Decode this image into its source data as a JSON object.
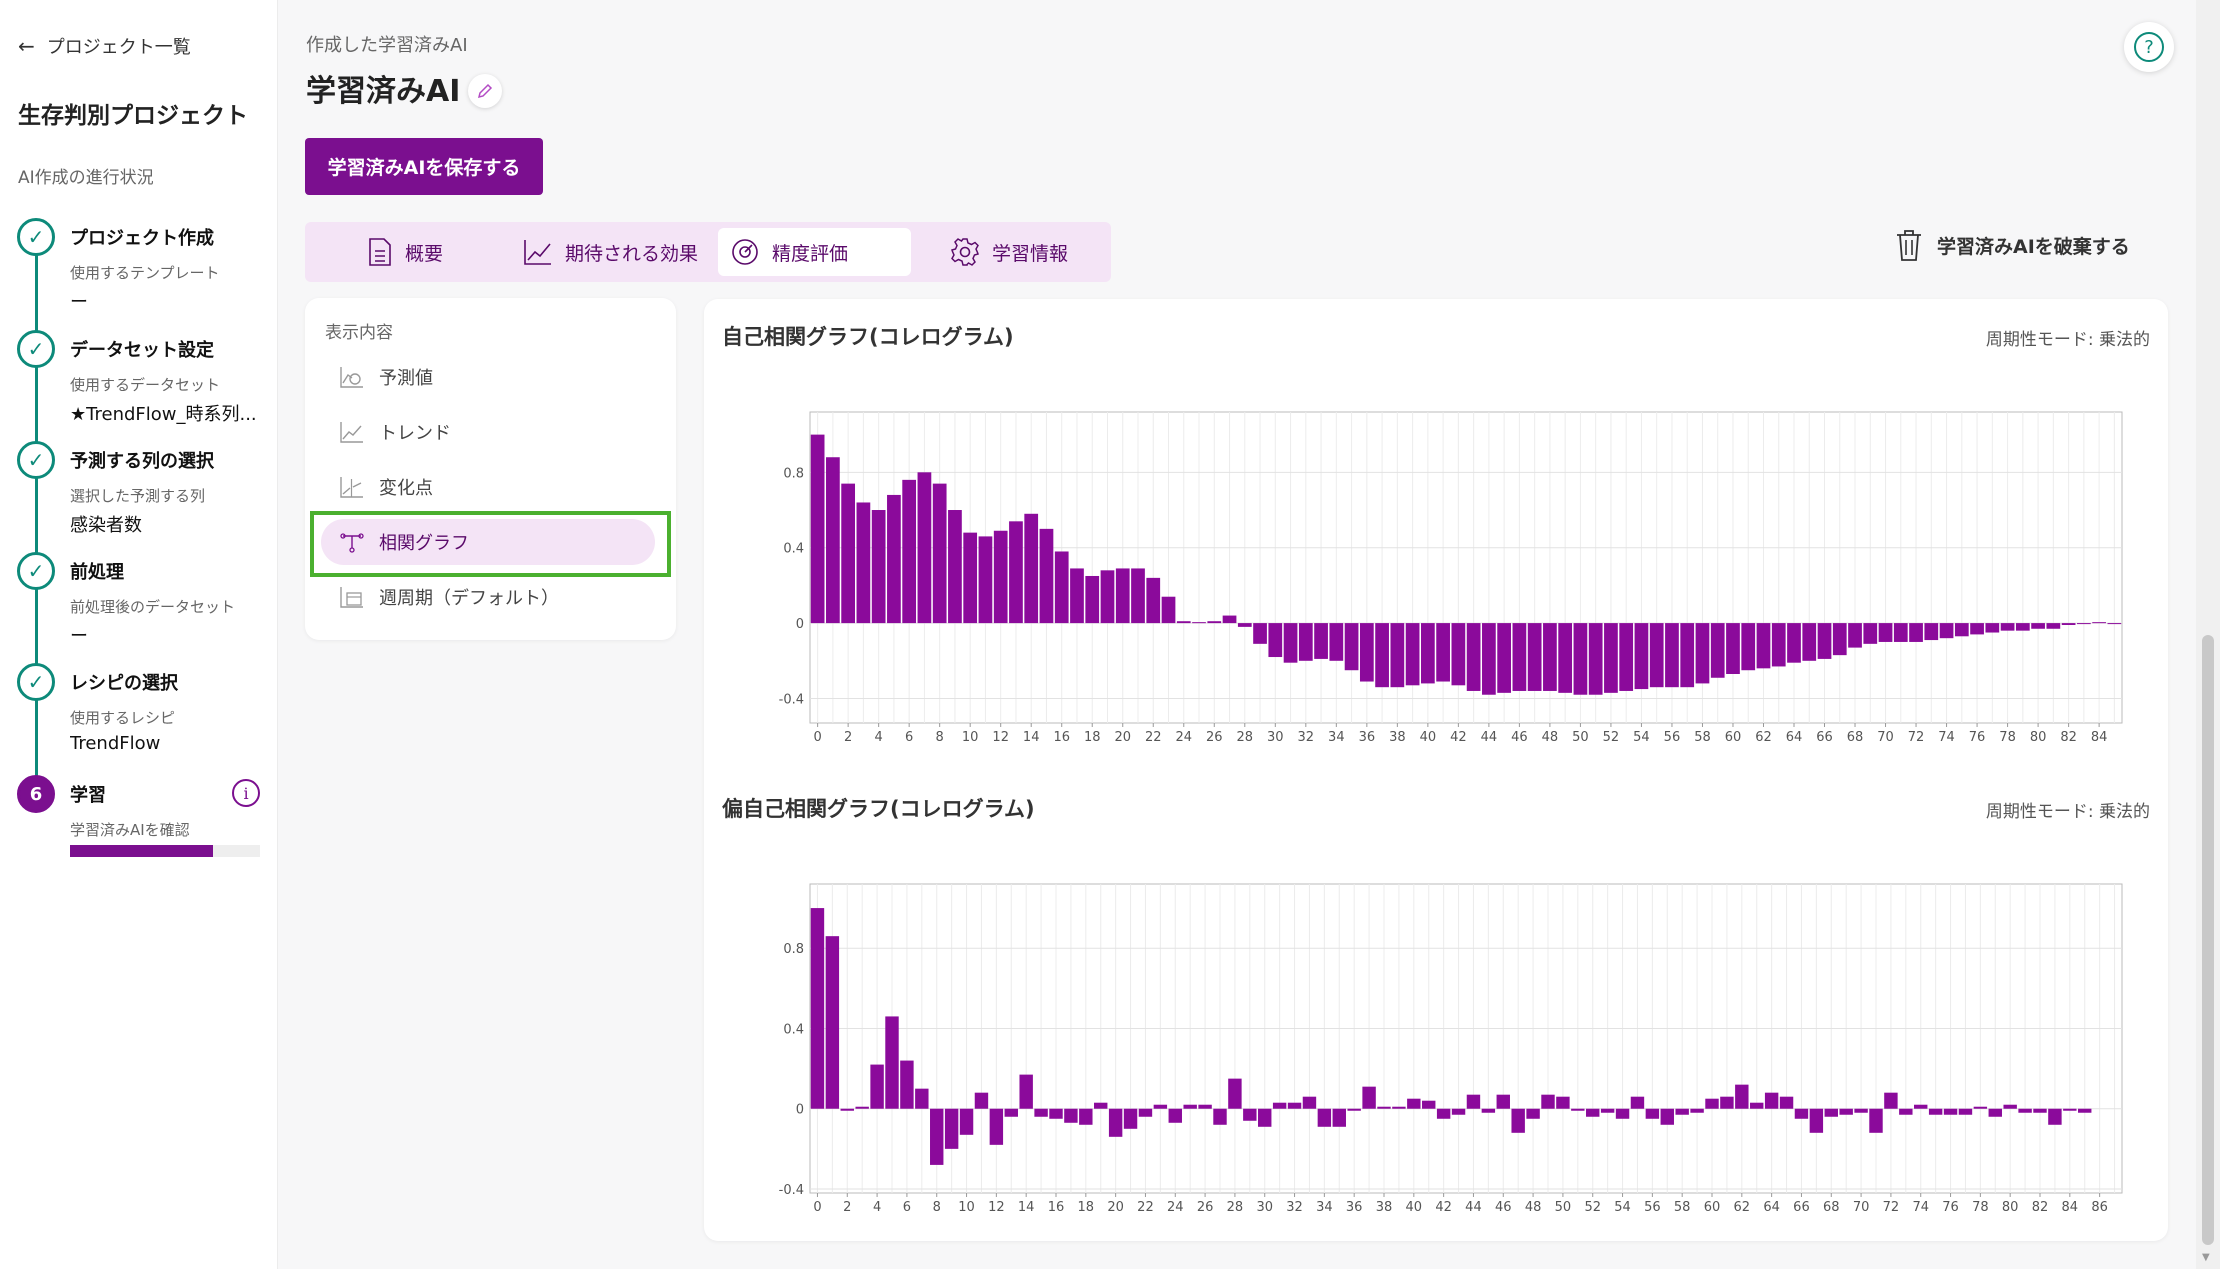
{
  "sidebar": {
    "back_label": "プロジェクト一覧",
    "project_title": "生存判別プロジェクト",
    "progress_label": "AI作成の進行状況",
    "steps": [
      {
        "title": "プロジェクト作成",
        "sub": "使用するテンプレート",
        "value": "ー",
        "status": "done"
      },
      {
        "title": "データセット設定",
        "sub": "使用するデータセット",
        "value": "★TrendFlow_時系列...",
        "status": "done"
      },
      {
        "title": "予測する列の選択",
        "sub": "選択した予測する列",
        "value": "感染者数",
        "status": "done"
      },
      {
        "title": "前処理",
        "sub": "前処理後のデータセット",
        "value": "ー",
        "status": "done"
      },
      {
        "title": "レシピの選択",
        "sub": "使用するレシピ",
        "value": "TrendFlow",
        "status": "done"
      },
      {
        "number": "6",
        "title": "学習",
        "sub": "学習済みAIを確認",
        "status": "active",
        "progress": 0.75
      }
    ]
  },
  "header": {
    "subtitle": "作成した学習済みAI",
    "title": "学習済みAI",
    "save_label": "学習済みAIを保存する",
    "discard_label": "学習済みAIを破棄する"
  },
  "tabs": [
    {
      "label": "概要",
      "icon": "document-icon"
    },
    {
      "label": "期待される効果",
      "icon": "line-chart-icon"
    },
    {
      "label": "精度評価",
      "icon": "gauge-icon",
      "active": true
    },
    {
      "label": "学習情報",
      "icon": "gear-icon"
    }
  ],
  "menu": {
    "heading": "表示内容",
    "items": [
      {
        "label": "予測値",
        "icon": "forecast-icon"
      },
      {
        "label": "トレンド",
        "icon": "trend-icon"
      },
      {
        "label": "変化点",
        "icon": "changepoint-icon"
      },
      {
        "label": "相関グラフ",
        "icon": "correlation-icon",
        "selected": true
      },
      {
        "label": "週周期（デフォルト）",
        "icon": "weekly-cycle-icon"
      }
    ]
  },
  "colors": {
    "accent": "#7b0f8f",
    "bar": "#8b0a9b",
    "check": "#0d8a7a",
    "highlight": "#4bb02f"
  },
  "chart_data": [
    {
      "type": "bar",
      "title": "自己相関グラフ(コレログラム)",
      "mode": "周期性モード: 乗法的",
      "x_start": 0,
      "x_ticks": [
        0,
        2,
        4,
        6,
        8,
        10,
        12,
        14,
        16,
        18,
        20,
        22,
        24,
        26,
        28,
        30,
        32,
        34,
        36,
        38,
        40,
        42,
        44,
        46,
        48,
        50,
        52,
        54,
        56,
        58,
        60,
        62,
        64,
        66,
        68,
        70,
        72,
        74,
        76,
        78,
        80,
        82,
        84
      ],
      "y_ticks": [
        0.8,
        0.4,
        0,
        -0.4
      ],
      "ylim": [
        -0.53,
        1.12
      ],
      "grid": true,
      "values": [
        1.0,
        0.88,
        0.74,
        0.64,
        0.6,
        0.68,
        0.76,
        0.8,
        0.74,
        0.6,
        0.48,
        0.46,
        0.49,
        0.54,
        0.58,
        0.5,
        0.38,
        0.29,
        0.25,
        0.28,
        0.29,
        0.29,
        0.24,
        0.14,
        0.01,
        0.005,
        0.01,
        0.04,
        -0.02,
        -0.11,
        -0.18,
        -0.21,
        -0.2,
        -0.19,
        -0.2,
        -0.25,
        -0.31,
        -0.34,
        -0.34,
        -0.33,
        -0.32,
        -0.31,
        -0.33,
        -0.36,
        -0.38,
        -0.37,
        -0.36,
        -0.36,
        -0.36,
        -0.37,
        -0.38,
        -0.38,
        -0.37,
        -0.36,
        -0.35,
        -0.34,
        -0.34,
        -0.34,
        -0.32,
        -0.29,
        -0.27,
        -0.25,
        -0.24,
        -0.23,
        -0.21,
        -0.2,
        -0.19,
        -0.17,
        -0.13,
        -0.11,
        -0.1,
        -0.1,
        -0.1,
        -0.09,
        -0.08,
        -0.07,
        -0.06,
        -0.05,
        -0.04,
        -0.04,
        -0.03,
        -0.03,
        -0.01,
        -0.005,
        0.005,
        -0.005
      ]
    },
    {
      "type": "bar",
      "title": "偏自己相関グラフ(コレログラム)",
      "mode": "周期性モード: 乗法的",
      "x_start": 0,
      "x_ticks": [
        0,
        2,
        4,
        6,
        8,
        10,
        12,
        14,
        16,
        18,
        20,
        22,
        24,
        26,
        28,
        30,
        32,
        34,
        36,
        38,
        40,
        42,
        44,
        46,
        48,
        50,
        52,
        54,
        56,
        58,
        60,
        62,
        64,
        66,
        68,
        70,
        72,
        74,
        76,
        78,
        80,
        82,
        84,
        86
      ],
      "y_ticks": [
        0.8,
        0.4,
        0,
        -0.4
      ],
      "ylim": [
        -0.42,
        1.12
      ],
      "grid": true,
      "values": [
        1.0,
        0.86,
        -0.01,
        0.01,
        0.22,
        0.46,
        0.24,
        0.1,
        -0.28,
        -0.2,
        -0.13,
        0.08,
        -0.18,
        -0.04,
        0.17,
        -0.04,
        -0.05,
        -0.07,
        -0.08,
        0.03,
        -0.14,
        -0.1,
        -0.04,
        0.02,
        -0.07,
        0.02,
        0.02,
        -0.08,
        0.15,
        -0.06,
        -0.09,
        0.03,
        0.03,
        0.06,
        -0.09,
        -0.09,
        -0.01,
        0.11,
        0.01,
        0.01,
        0.05,
        0.04,
        -0.05,
        -0.03,
        0.07,
        -0.02,
        0.07,
        -0.12,
        -0.05,
        0.07,
        0.06,
        -0.01,
        -0.04,
        -0.02,
        -0.05,
        0.06,
        -0.05,
        -0.08,
        -0.03,
        -0.02,
        0.05,
        0.06,
        0.12,
        0.03,
        0.08,
        0.06,
        -0.05,
        -0.12,
        -0.04,
        -0.03,
        -0.02,
        -0.12,
        0.08,
        -0.03,
        0.02,
        -0.03,
        -0.03,
        -0.03,
        0.01,
        -0.04,
        0.02,
        -0.02,
        -0.02,
        -0.08,
        -0.01,
        -0.02
      ]
    }
  ]
}
